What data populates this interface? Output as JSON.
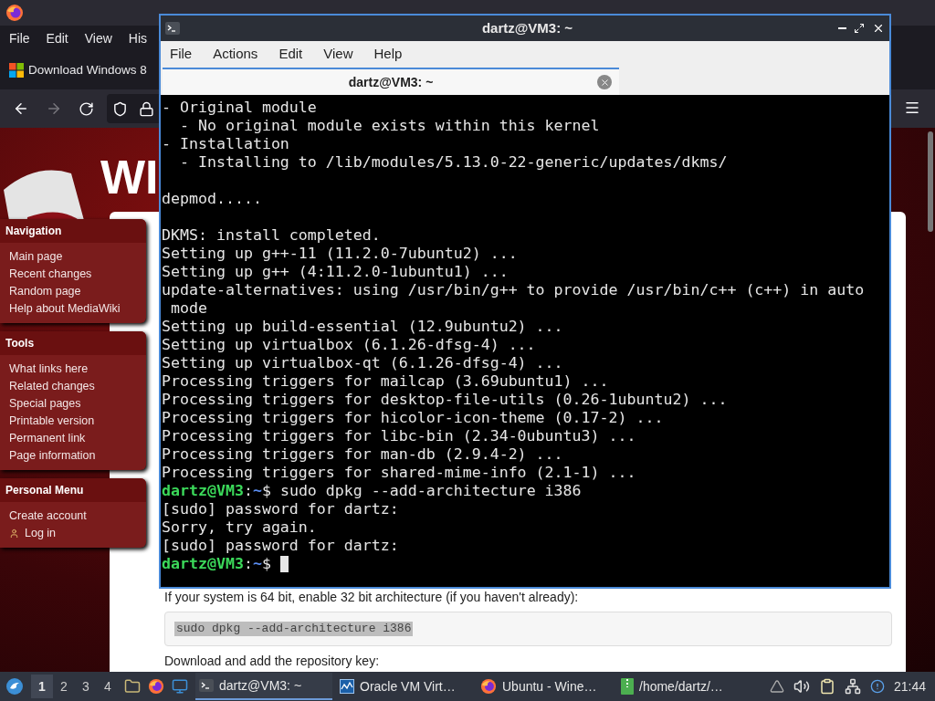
{
  "browser": {
    "menu": [
      "File",
      "Edit",
      "View",
      "His"
    ],
    "tab": {
      "title": "Download Windows 8"
    },
    "wiki": {
      "logo": "WI",
      "portlets": [
        {
          "title": "Navigation",
          "links": [
            {
              "label": "Main page"
            },
            {
              "label": "Recent changes"
            },
            {
              "label": "Random page"
            },
            {
              "label": "Help about MediaWiki"
            }
          ]
        },
        {
          "title": "Tools",
          "links": [
            {
              "label": "What links here"
            },
            {
              "label": "Related changes"
            },
            {
              "label": "Special pages"
            },
            {
              "label": "Printable version"
            },
            {
              "label": "Permanent link"
            },
            {
              "label": "Page information"
            }
          ]
        },
        {
          "title": "Personal Menu",
          "links": [
            {
              "label": "Create account"
            },
            {
              "label": "Log in",
              "kind": "user"
            }
          ]
        }
      ],
      "content": [
        {
          "kind": "text",
          "text": "If your system is 64 bit, enable 32 bit architecture (if you haven't already):"
        },
        {
          "kind": "code",
          "text": "sudo dpkg --add-architecture i386"
        },
        {
          "kind": "text",
          "text": "Download and add the repository key:"
        }
      ]
    }
  },
  "terminal": {
    "title": "dartz@VM3: ~",
    "menu": [
      "File",
      "Actions",
      "Edit",
      "View",
      "Help"
    ],
    "tab": {
      "title": "dartz@VM3: ~"
    },
    "lines": [
      {
        "kind": "output",
        "text": "- Original module"
      },
      {
        "kind": "output",
        "text": "  - No original module exists within this kernel"
      },
      {
        "kind": "output",
        "text": "- Installation"
      },
      {
        "kind": "output",
        "text": "  - Installing to /lib/modules/5.13.0-22-generic/updates/dkms/"
      },
      {
        "kind": "blank"
      },
      {
        "kind": "output",
        "text": "depmod....."
      },
      {
        "kind": "blank"
      },
      {
        "kind": "output",
        "text": "DKMS: install completed."
      },
      {
        "kind": "output",
        "text": "Setting up g++-11 (11.2.0-7ubuntu2) ..."
      },
      {
        "kind": "output",
        "text": "Setting up g++ (4:11.2.0-1ubuntu1) ..."
      },
      {
        "kind": "output",
        "text": "update-alternatives: using /usr/bin/g++ to provide /usr/bin/c++ (c++) in auto"
      },
      {
        "kind": "output",
        "text": " mode"
      },
      {
        "kind": "output",
        "text": "Setting up build-essential (12.9ubuntu2) ..."
      },
      {
        "kind": "output",
        "text": "Setting up virtualbox (6.1.26-dfsg-4) ..."
      },
      {
        "kind": "output",
        "text": "Setting up virtualbox-qt (6.1.26-dfsg-4) ..."
      },
      {
        "kind": "output",
        "text": "Processing triggers for mailcap (3.69ubuntu1) ..."
      },
      {
        "kind": "output",
        "text": "Processing triggers for desktop-file-utils (0.26-1ubuntu2) ..."
      },
      {
        "kind": "output",
        "text": "Processing triggers for hicolor-icon-theme (0.17-2) ..."
      },
      {
        "kind": "output",
        "text": "Processing triggers for libc-bin (2.34-0ubuntu3) ..."
      },
      {
        "kind": "output",
        "text": "Processing triggers for man-db (2.9.4-2) ..."
      },
      {
        "kind": "output",
        "text": "Processing triggers for shared-mime-info (2.1-1) ..."
      },
      {
        "kind": "prompt",
        "user": "dartz@VM3",
        "sep": ":",
        "path": "~",
        "command": "$ sudo dpkg --add-architecture i386"
      },
      {
        "kind": "output",
        "text": "[sudo] password for dartz:"
      },
      {
        "kind": "output",
        "text": "Sorry, try again."
      },
      {
        "kind": "output",
        "text": "[sudo] password for dartz:"
      },
      {
        "kind": "prompt",
        "user": "dartz@VM3",
        "sep": ":",
        "path": "~",
        "command": "$ ",
        "cursor": true
      }
    ]
  },
  "taskbar": {
    "workspaces": [
      {
        "label": "1",
        "selected": true
      },
      {
        "label": "2",
        "selected": false
      },
      {
        "label": "3",
        "selected": false
      },
      {
        "label": "4",
        "selected": false
      }
    ],
    "tasks": [
      {
        "label": "dartz@VM3: ~",
        "kind": "terminal",
        "selected": true
      },
      {
        "label": "Oracle VM Virt…",
        "kind": "vbox",
        "selected": false
      },
      {
        "label": "Ubuntu - Wine…",
        "kind": "firefox",
        "selected": false
      },
      {
        "label": "/home/dartz/…",
        "kind": "archive",
        "selected": false
      }
    ],
    "clock": "21:44"
  }
}
